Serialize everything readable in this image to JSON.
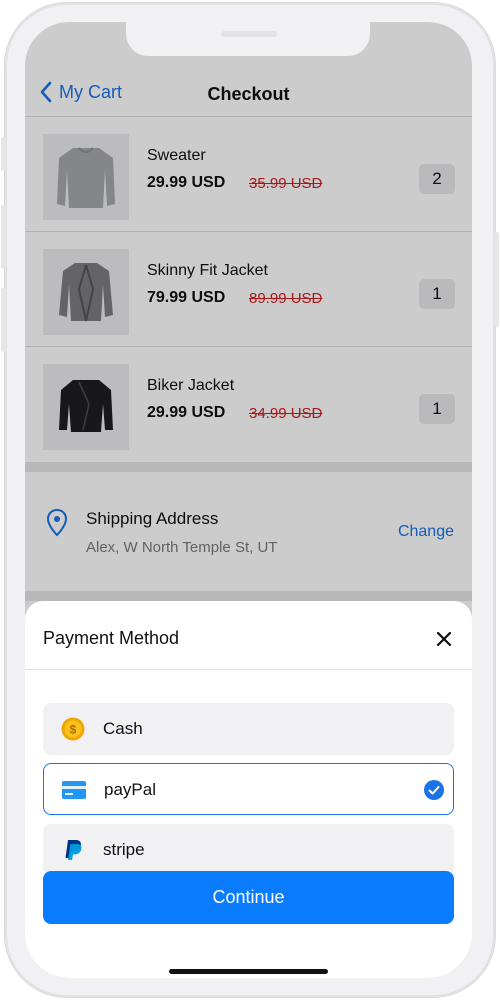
{
  "nav": {
    "back_label": "My Cart",
    "title": "Checkout"
  },
  "cart": {
    "items": [
      {
        "name": "Sweater",
        "price": "29.99 USD",
        "old_price": "35.99 USD",
        "quantity": "2"
      },
      {
        "name": "Skinny Fit Jacket",
        "price": "79.99 USD",
        "old_price": "89.99 USD",
        "quantity": "1"
      },
      {
        "name": "Biker Jacket",
        "price": "29.99 USD",
        "old_price": "34.99 USD",
        "quantity": "1"
      }
    ]
  },
  "shipping": {
    "title": "Shipping Address",
    "address": "Alex, W North Temple St, UT",
    "change_label": "Change"
  },
  "payment": {
    "title": "Payment Method",
    "options": [
      {
        "label": "Cash",
        "icon": "coin-icon",
        "selected": false
      },
      {
        "label": "payPal",
        "icon": "card-icon",
        "selected": true
      },
      {
        "label": "stripe",
        "icon": "paypal-logo-icon",
        "selected": false
      }
    ],
    "continue_label": "Continue"
  },
  "colors": {
    "accent": "#0a7cff",
    "link": "#1a73e8",
    "old_price": "#d32020"
  }
}
